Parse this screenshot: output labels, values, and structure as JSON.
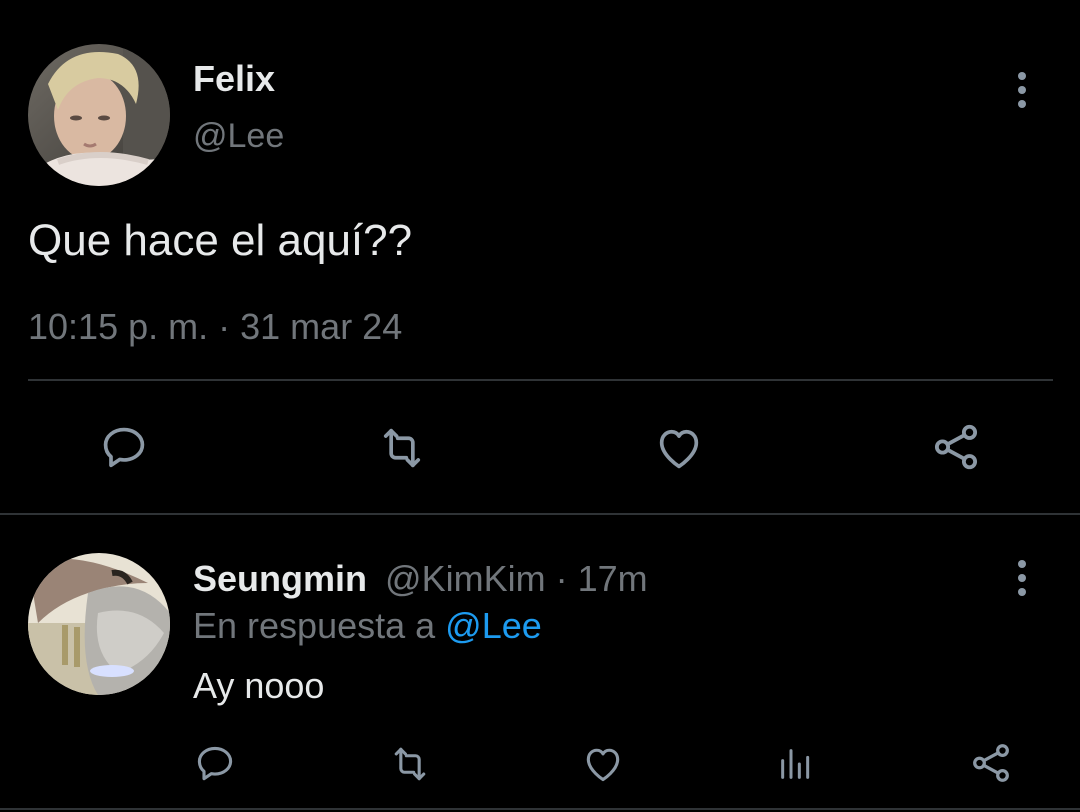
{
  "colors": {
    "background": "#000000",
    "primary_text": "#e7e9ea",
    "secondary_text": "#71767b",
    "accent": "#1d9bf0",
    "divider": "#2f3336",
    "icon": "#8b98a5"
  },
  "main_tweet": {
    "author_name": "Felix",
    "author_handle": "@Lee",
    "text": "Que hace el aquí??",
    "time": "10:15 p. m.",
    "separator": "·",
    "date": "31 mar 24",
    "more_icon": "more-vertical-icon",
    "actions": [
      {
        "name": "reply",
        "icon": "comment-icon"
      },
      {
        "name": "retweet",
        "icon": "retweet-icon"
      },
      {
        "name": "like",
        "icon": "heart-icon"
      },
      {
        "name": "share",
        "icon": "share-icon"
      }
    ]
  },
  "reply_tweet": {
    "author_name": "Seungmin",
    "author_handle": "@KimKim",
    "separator": "·",
    "age": "17m",
    "replying_to_prefix": "En respuesta a",
    "replying_to_handle": "@Lee",
    "text": "Ay nooo",
    "more_icon": "more-vertical-icon",
    "actions": [
      {
        "name": "reply",
        "icon": "comment-icon"
      },
      {
        "name": "retweet",
        "icon": "retweet-icon"
      },
      {
        "name": "like",
        "icon": "heart-icon"
      },
      {
        "name": "views",
        "icon": "bar-chart-icon"
      },
      {
        "name": "share",
        "icon": "share-icon"
      }
    ]
  }
}
